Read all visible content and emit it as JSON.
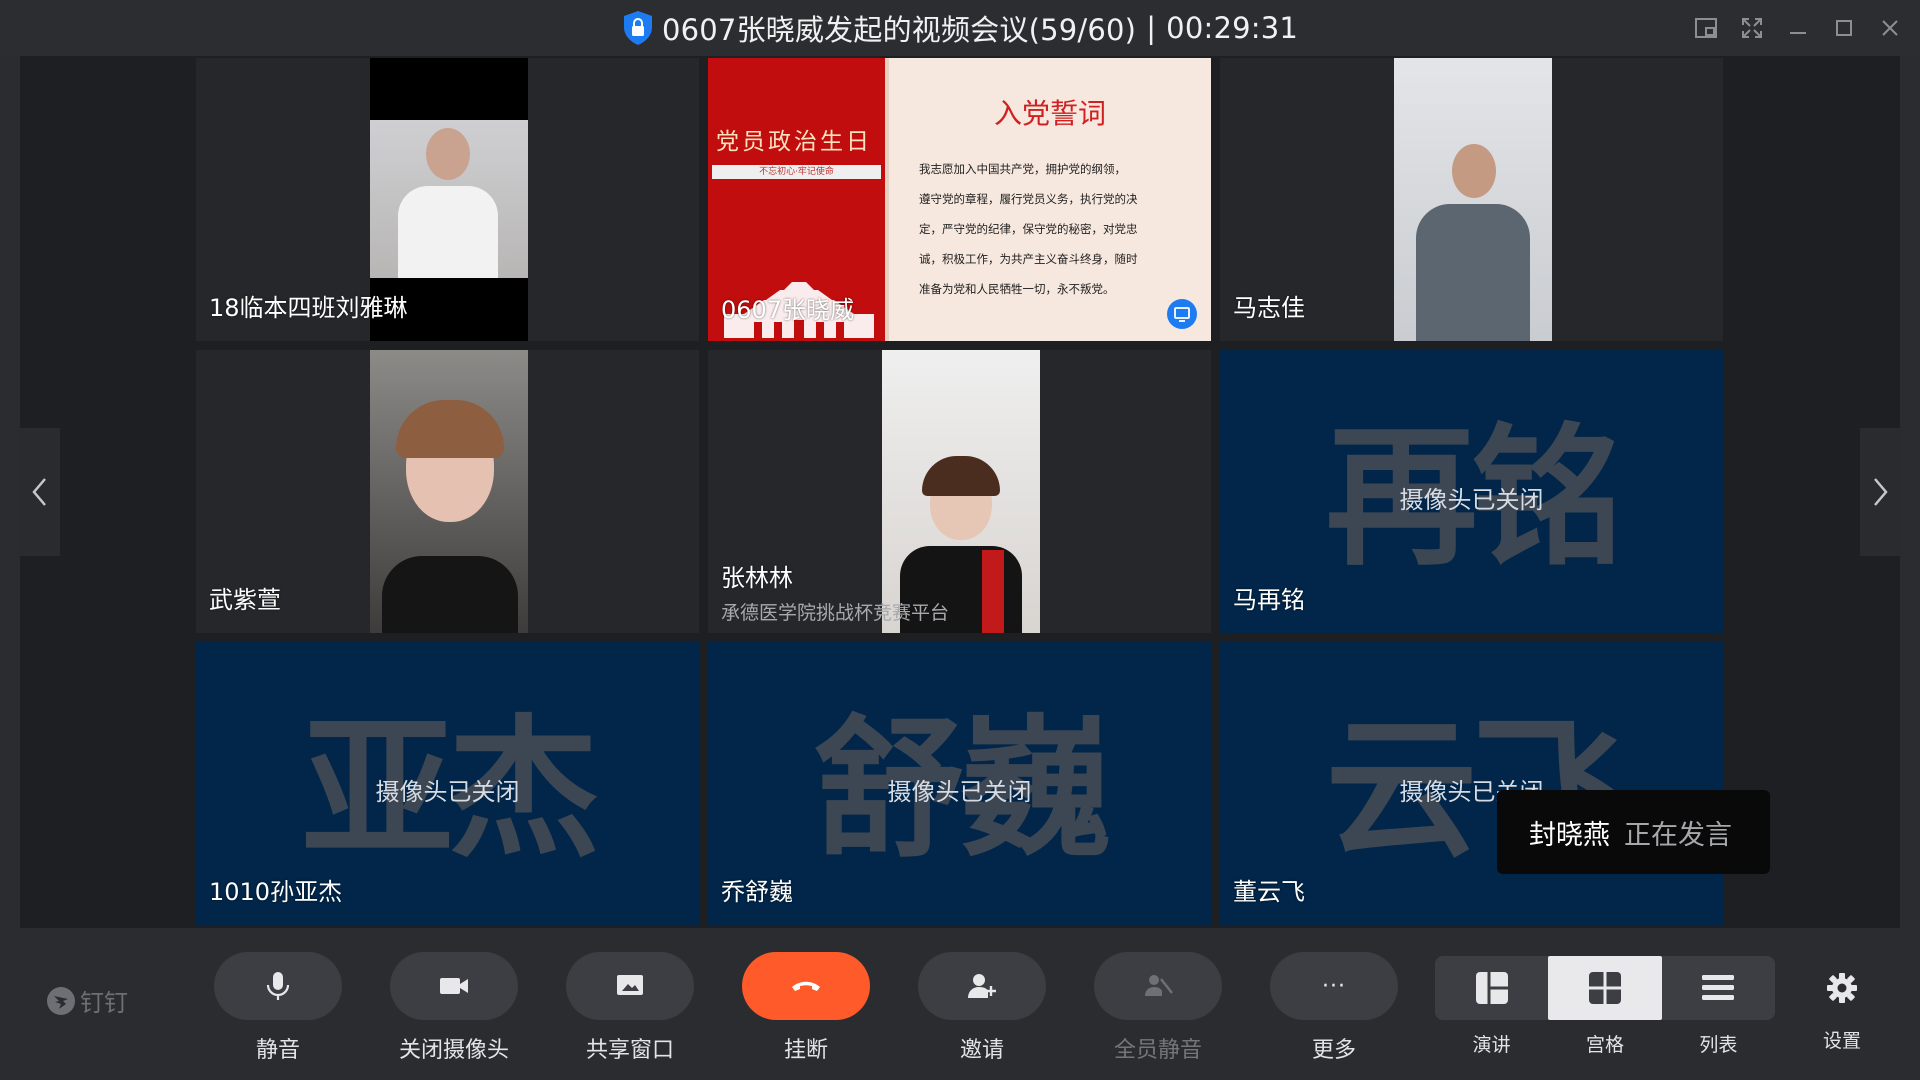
{
  "window": {
    "title": "0607张晓威发起的视频会议(59/60)",
    "separator": "|",
    "timer": "00:29:31"
  },
  "tiles": [
    {
      "name": "18临本四班刘雅琳",
      "camera": "on"
    },
    {
      "name": "0607张晓威",
      "camera": "sharing"
    },
    {
      "name": "马志佳",
      "camera": "on"
    },
    {
      "name": "武紫萱",
      "camera": "on"
    },
    {
      "name": "张林林",
      "subname": "承德医学院挑战杯竞赛平台",
      "camera": "on"
    },
    {
      "name": "马再铭",
      "avatar_text": "再铭",
      "status": "摄像头已关闭",
      "camera": "off"
    },
    {
      "name": "1010孙亚杰",
      "avatar_text": "亚杰",
      "status": "摄像头已关闭",
      "camera": "off"
    },
    {
      "name": "乔舒巍",
      "avatar_text": "舒巍",
      "status": "摄像头已关闭",
      "camera": "off"
    },
    {
      "name": "董云飞",
      "avatar_text": "云飞",
      "status": "摄像头已关闭",
      "camera": "off"
    }
  ],
  "slide": {
    "left_title": "党员政治生日",
    "left_band": "不忘初心·牢记使命",
    "right_title": "入党誓词",
    "oath_lines": [
      "我志愿加入中国共产党，拥护党的纲领，",
      "遵守党的章程，履行党员义务，执行党的决",
      "定，严守党的纪律，保守党的秘密，对党忠",
      "诚，积极工作，为共产主义奋斗终身，随时",
      "准备为党和人民牺牲一切，永不叛党。"
    ]
  },
  "speaking": {
    "who": "封晓燕",
    "state": "正在发言"
  },
  "brand": "钉钉",
  "toolbar": {
    "mute": "静音",
    "camera_off": "关闭摄像头",
    "share": "共享窗口",
    "hangup": "挂断",
    "invite": "邀请",
    "mute_all": "全员静音",
    "more": "更多",
    "more_glyph": "···",
    "view_speaker": "演讲",
    "view_grid": "宫格",
    "view_list": "列表",
    "settings": "设置"
  },
  "colors": {
    "hangup": "#ff5a2a",
    "camera_off_tile": "#01264a",
    "shield": "#1e7cf2"
  }
}
